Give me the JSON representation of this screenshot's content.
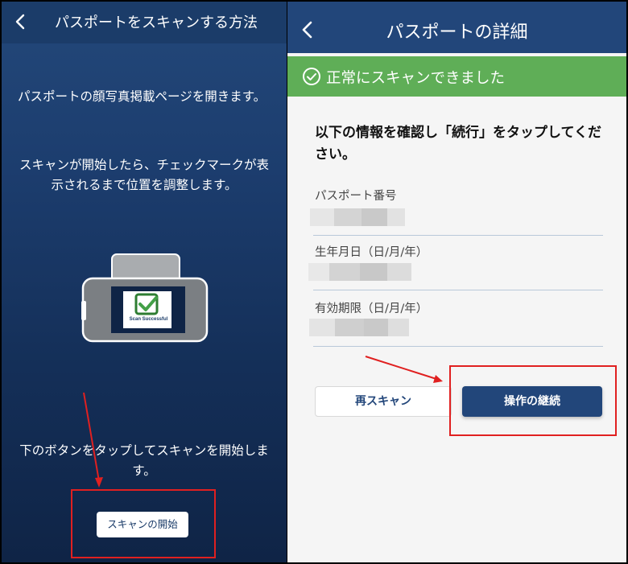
{
  "left": {
    "header": {
      "title": "パスポートをスキャンする方法",
      "back_icon": "chevron-left-icon"
    },
    "instruction_1": "パスポートの顔写真掲載ページを開きます。",
    "instruction_2": "スキャンが開始したら、チェックマークが表示されるまで位置を調整します。",
    "illustration": {
      "icon": "phone-scan-icon",
      "card_label": "Scan Successful"
    },
    "instruction_3": "下のボタンをタップしてスキャンを開始します。",
    "start_button_label": "スキャンの開始"
  },
  "right": {
    "header": {
      "title": "パスポートの詳細",
      "back_icon": "chevron-left-icon"
    },
    "success_banner": {
      "text": "正常にスキャンできました",
      "icon": "check-circle-icon"
    },
    "instruction": "以下の情報を確認し「続行」をタップしてください。",
    "fields": [
      {
        "label": "パスポート番号"
      },
      {
        "label": "生年月日（日/月/年）"
      },
      {
        "label": "有効期限（日/月/年）"
      }
    ],
    "rescan_button_label": "再スキャン",
    "continue_button_label": "操作の継続"
  },
  "colors": {
    "header_blue": "#22467a",
    "success_green": "#5fae57",
    "highlight_red": "#e02020"
  }
}
